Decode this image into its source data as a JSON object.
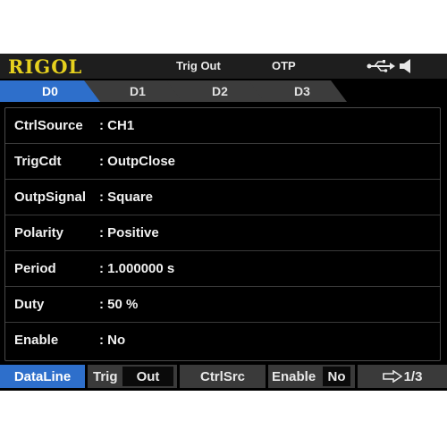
{
  "titlebar": {
    "brand": "RIGOL",
    "trig_out": "Trig Out",
    "otp": "OTP",
    "icons": [
      "usb-icon",
      "speaker-icon"
    ],
    "brand_color": "#e6d11e"
  },
  "tabs": [
    {
      "label": "D0",
      "active": true
    },
    {
      "label": "D1",
      "active": false
    },
    {
      "label": "D2",
      "active": false
    },
    {
      "label": "D3",
      "active": false
    }
  ],
  "params": [
    {
      "label": "CtrlSource",
      "value": ": CH1"
    },
    {
      "label": "TrigCdt",
      "value": ": OutpClose"
    },
    {
      "label": "OutpSignal",
      "value": ": Square"
    },
    {
      "label": "Polarity",
      "value": ": Positive"
    },
    {
      "label": "Period",
      "value": ": 1.000000 s"
    },
    {
      "label": "Duty",
      "value": ": 50 %"
    },
    {
      "label": "Enable",
      "value": ": No"
    }
  ],
  "menu": {
    "dataline": "DataLine",
    "trig_label": "Trig",
    "trig_value": "Out",
    "ctrlsrc": "CtrlSrc",
    "enable_label": "Enable",
    "enable_value": "No",
    "page": "1/3"
  },
  "colors": {
    "accent": "#2e6fcb",
    "background": "#000000"
  }
}
